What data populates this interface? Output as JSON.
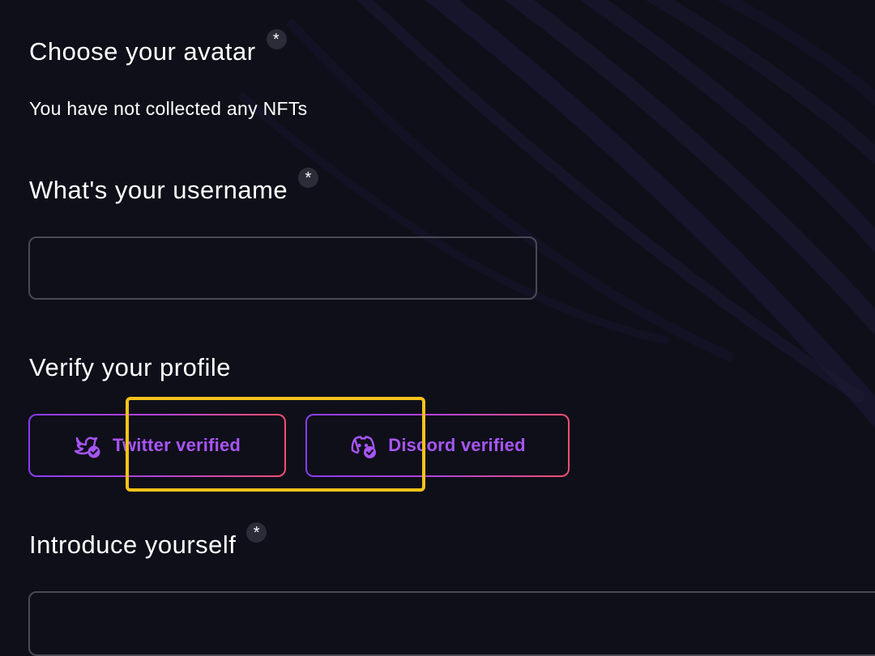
{
  "avatar_section": {
    "title": "Choose your avatar",
    "required_mark": "*",
    "empty_message": "You have not collected any NFTs"
  },
  "username_section": {
    "title": "What's your username",
    "required_mark": "*",
    "input_value": "",
    "input_placeholder": ""
  },
  "verify_section": {
    "title": "Verify your profile",
    "buttons": [
      {
        "label": "Twitter verified",
        "icon": "twitter-verified-icon"
      },
      {
        "label": "Discord verified",
        "icon": "discord-verified-icon"
      }
    ]
  },
  "intro_section": {
    "title": "Introduce yourself",
    "required_mark": "*"
  },
  "colors": {
    "background": "#0f0f1a",
    "accent_purple": "#a855f7",
    "gradient_start": "#8a3df0",
    "gradient_end": "#f0506e",
    "highlight": "#f7c31a",
    "input_border": "#4a4a56"
  }
}
